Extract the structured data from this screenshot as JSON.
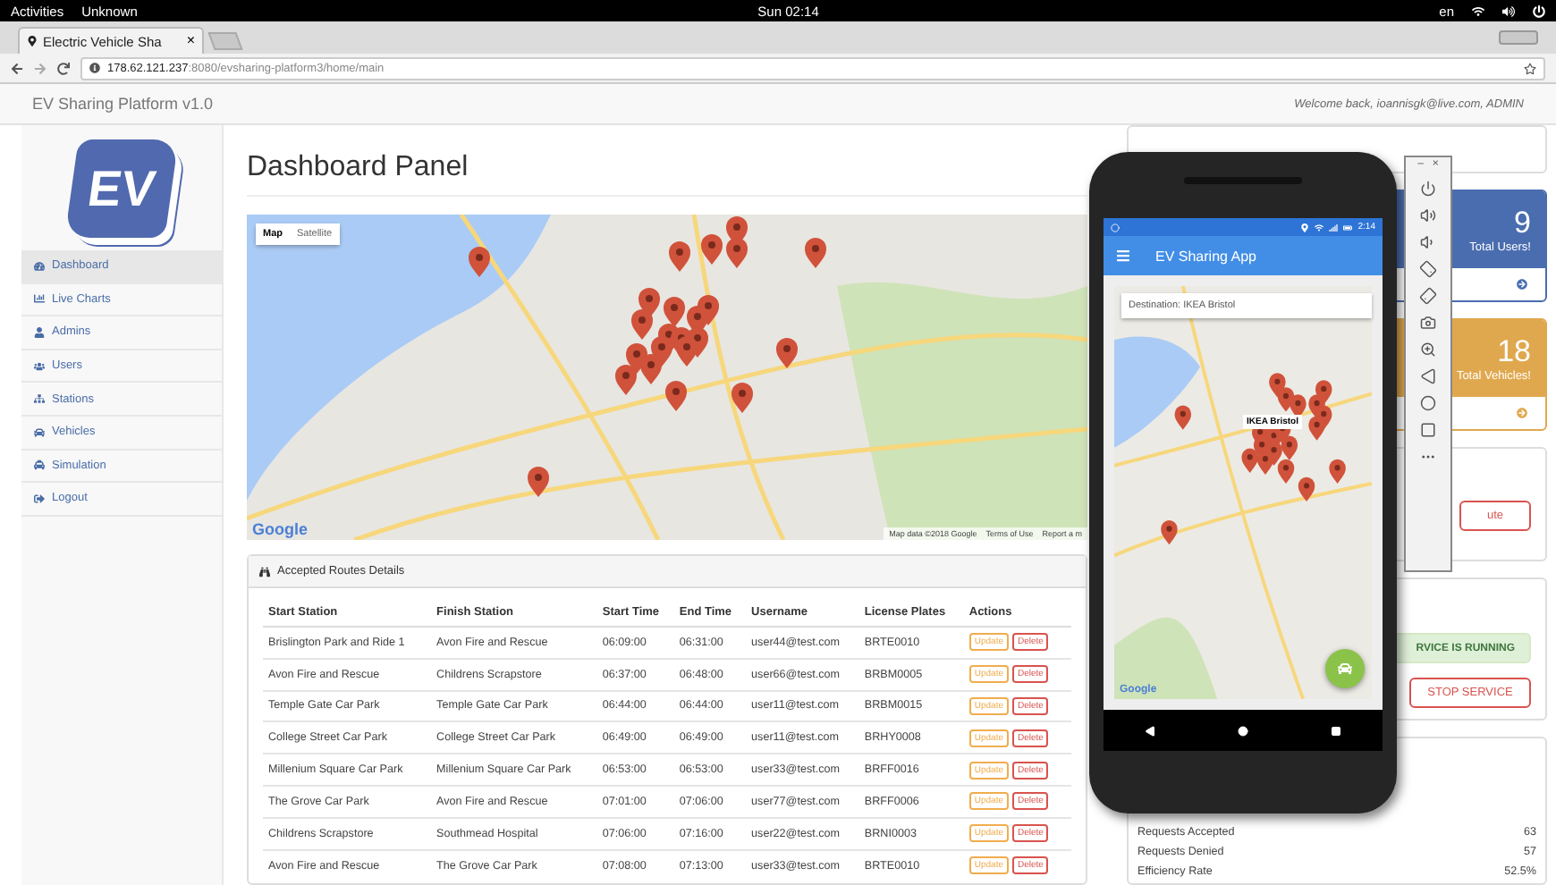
{
  "os_bar": {
    "activities": "Activities",
    "app_menu": "Unknown",
    "clock": "Sun 02:14",
    "language": "en"
  },
  "browser": {
    "tab_title": "Electric Vehicle Sha",
    "tab_close": "×",
    "url_host": "178.62.121.237",
    "url_path": ":8080/evsharing-platform3/home/main"
  },
  "header": {
    "title": "EV Sharing Platform v1.0",
    "welcome": "Welcome back, ioannisgk@live.com, ADMIN"
  },
  "logo": {
    "text": "EV"
  },
  "sidebar": {
    "items": [
      {
        "label": "Dashboard",
        "selected": true
      },
      {
        "label": "Live Charts",
        "selected": false
      },
      {
        "label": "Admins",
        "selected": false
      },
      {
        "label": "Users",
        "selected": false
      },
      {
        "label": "Stations",
        "selected": false
      },
      {
        "label": "Vehicles",
        "selected": false
      },
      {
        "label": "Simulation",
        "selected": false
      },
      {
        "label": "Logout",
        "selected": false
      }
    ]
  },
  "page_title": "Dashboard Panel",
  "map": {
    "types": [
      {
        "label": "Map",
        "selected": true
      },
      {
        "label": "Satellite",
        "selected": false
      }
    ],
    "logo": "Google",
    "attribution": [
      "Map data ©2018 Google",
      "Terms of Use",
      "Report a m"
    ]
  },
  "routes": {
    "title": "Accepted Routes Details",
    "columns": [
      "Start Station",
      "Finish Station",
      "Start Time",
      "End Time",
      "Username",
      "License Plates",
      "Actions"
    ],
    "rows": [
      {
        "cells": [
          "Brislington Park and Ride 1",
          "Avon Fire and Rescue",
          "06:09:00",
          "06:31:00",
          "user44@test.com",
          "BRTE0010"
        ],
        "actions": [
          {
            "label": "Update",
            "kind": "update"
          },
          {
            "label": "Delete",
            "kind": "delete"
          }
        ]
      },
      {
        "cells": [
          "Avon Fire and Rescue",
          "Childrens Scrapstore",
          "06:37:00",
          "06:48:00",
          "user66@test.com",
          "BRBM0005"
        ],
        "actions": [
          {
            "label": "Update",
            "kind": "update"
          },
          {
            "label": "Delete",
            "kind": "delete"
          }
        ]
      },
      {
        "cells": [
          "Temple Gate Car Park",
          "Temple Gate Car Park",
          "06:44:00",
          "06:44:00",
          "user11@test.com",
          "BRBM0015"
        ],
        "actions": [
          {
            "label": "Update",
            "kind": "update"
          },
          {
            "label": "Delete",
            "kind": "delete"
          }
        ]
      },
      {
        "cells": [
          "College Street Car Park",
          "College Street Car Park",
          "06:49:00",
          "06:49:00",
          "user11@test.com",
          "BRHY0008"
        ],
        "actions": [
          {
            "label": "Update",
            "kind": "update"
          },
          {
            "label": "Delete",
            "kind": "delete"
          }
        ]
      },
      {
        "cells": [
          "Millenium Square Car Park",
          "Millenium Square Car Park",
          "06:53:00",
          "06:53:00",
          "user33@test.com",
          "BRFF0016"
        ],
        "actions": [
          {
            "label": "Update",
            "kind": "update"
          },
          {
            "label": "Delete",
            "kind": "delete"
          }
        ]
      },
      {
        "cells": [
          "The Grove Car Park",
          "Avon Fire and Rescue",
          "07:01:00",
          "07:06:00",
          "user77@test.com",
          "BRFF0006"
        ],
        "actions": [
          {
            "label": "Update",
            "kind": "update"
          },
          {
            "label": "Delete",
            "kind": "delete"
          }
        ]
      },
      {
        "cells": [
          "Childrens Scrapstore",
          "Southmead Hospital",
          "07:06:00",
          "07:16:00",
          "user22@test.com",
          "BRNI0003"
        ],
        "actions": [
          {
            "label": "Update",
            "kind": "update"
          },
          {
            "label": "Delete",
            "kind": "delete"
          }
        ]
      },
      {
        "cells": [
          "Avon Fire and Rescue",
          "The Grove Car Park",
          "07:08:00",
          "07:13:00",
          "user33@test.com",
          "BRTE0010"
        ],
        "actions": [
          {
            "label": "Update",
            "kind": "update"
          },
          {
            "label": "Delete",
            "kind": "delete"
          }
        ]
      }
    ]
  },
  "stats_cards": [
    {
      "value": "9",
      "label": "Total Users!",
      "color": "#4a6db0"
    },
    {
      "value": "18",
      "label": "Total Vehicles!",
      "color": "#e0a84e"
    }
  ],
  "add_route_button": "ute",
  "service": {
    "status": "RVICE IS RUNNING",
    "button": "STOP SERVICE"
  },
  "requests": [
    {
      "label": "Requests Accepted",
      "value": "63"
    },
    {
      "label": "Requests Denied",
      "value": "57"
    },
    {
      "label": "Efficiency Rate",
      "value": "52.5%"
    }
  ],
  "phone": {
    "clock": "2:14",
    "app_title": "EV Sharing App",
    "destination": "Destination: IKEA Bristol",
    "marker_label": "IKEA Bristol",
    "map_logo": "Google"
  },
  "emulator": {
    "minimize": "–",
    "close": "×"
  }
}
